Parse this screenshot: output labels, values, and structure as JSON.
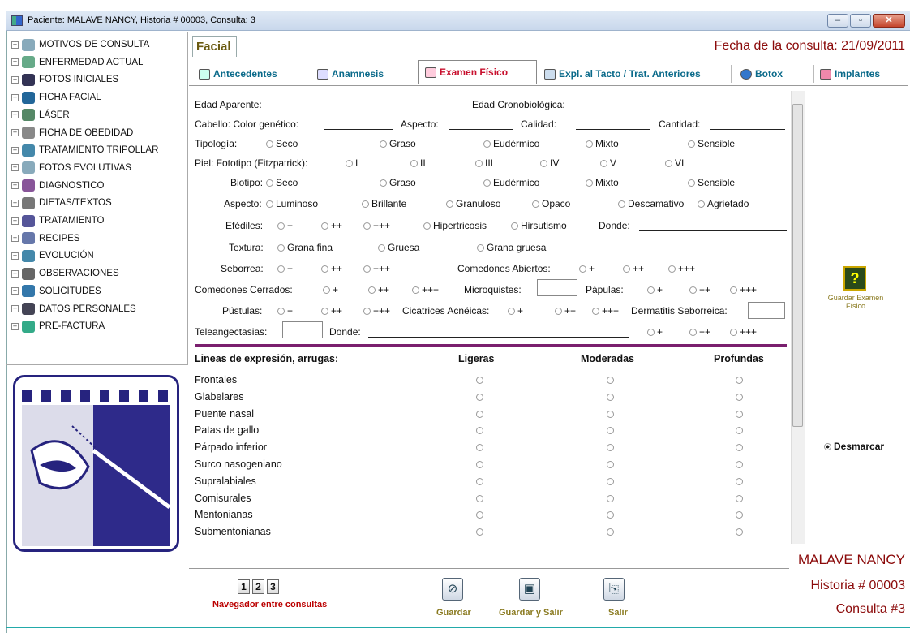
{
  "window": {
    "title": "Paciente: MALAVE  NANCY, Historia # 00003, Consulta: 3",
    "min": "–",
    "max": "▫",
    "close": "✕"
  },
  "tree": [
    "MOTIVOS DE CONSULTA",
    "ENFERMEDAD ACTUAL",
    "FOTOS INICIALES",
    "FICHA FACIAL",
    "LÁSER",
    "FICHA DE OBEDIDAD",
    "TRATAMIENTO TRIPOLLAR",
    "FOTOS EVOLUTIVAS",
    "DIAGNOSTICO",
    "DIETAS/TEXTOS",
    "TRATAMIENTO",
    "RECIPES",
    "EVOLUCIÓN",
    "OBSERVACIONES",
    "SOLICITUDES",
    "DATOS PERSONALES",
    "PRE-FACTURA"
  ],
  "header": {
    "facial_tab": "Facial",
    "fecha": "Fecha de la consulta: 21/09/2011"
  },
  "tabs": [
    "Antecedentes",
    "Anamnesis",
    "Examen Físico",
    "Expl. al Tacto / Trat. Anteriores",
    "Botox",
    "Implantes"
  ],
  "form": {
    "edad_aparente": "Edad Aparente:",
    "edad_crono": "Edad Cronobiológica:",
    "cabello": "Cabello: Color genético:",
    "aspecto": "Aspecto:",
    "calidad": "Calidad:",
    "cantidad": "Cantidad:",
    "tipologia": "Tipología:",
    "tipologia_opts": [
      "Seco",
      "Graso",
      "Eudérmico",
      "Mixto",
      "Sensible"
    ],
    "fototipo": "Piel: Fototipo (Fitzpatrick):",
    "fototipo_opts": [
      "I",
      "II",
      "III",
      "IV",
      "V",
      "VI"
    ],
    "biotipo": "Biotipo:",
    "biotipo_opts": [
      "Seco",
      "Graso",
      "Eudérmico",
      "Mixto",
      "Sensible"
    ],
    "aspecto2": "Aspecto:",
    "aspecto_opts": [
      "Luminoso",
      "Brillante",
      "Granuloso",
      "Opaco",
      "Descamativo",
      "Agrietado"
    ],
    "efelides": "Efédiles:",
    "plus": [
      "+",
      "++",
      "+++"
    ],
    "hipertricosis": "Hipertricosis",
    "hirsutismo": "Hirsutismo",
    "donde": "Donde:",
    "textura": "Textura:",
    "textura_opts": [
      "Grana fina",
      "Gruesa",
      "Grana gruesa"
    ],
    "seborrea": "Seborrea:",
    "comedones_abiertos": "Comedones Abiertos:",
    "comedones_cerrados": "Comedones Cerrados:",
    "microquistes": "Microquistes:",
    "papulas": "Pápulas:",
    "pustulas": "Pústulas:",
    "cicatrices": "Cicatrices Acnéicas:",
    "dermatitis": "Dermatitis Seborreica:",
    "teleangectasias": "Teleangectasias:",
    "donde2": "Donde:"
  },
  "grid": {
    "headers": [
      "Lineas de expresión, arrugas:",
      "Ligeras",
      "Moderadas",
      "Profundas"
    ],
    "rows": [
      "Frontales",
      "Glabelares",
      "Puente nasal",
      "Patas de gallo",
      "Párpado inferior",
      "Surco nasogeniano",
      "Supralabiales",
      "Comisurales",
      "Mentonianas",
      "Submentonianas"
    ]
  },
  "right": {
    "guardar_ef": "Guardar Examen Físico",
    "desmarcar": "Desmarcar",
    "patient": "MALAVE NANCY",
    "historia": "Historia # 00003",
    "consulta": "Consulta #3"
  },
  "bottom": {
    "nav": [
      "1",
      "2",
      "3"
    ],
    "nav_label": "Navegador entre consultas",
    "guardar": "Guardar",
    "guardar_salir": "Guardar y Salir",
    "salir": "Salir"
  }
}
